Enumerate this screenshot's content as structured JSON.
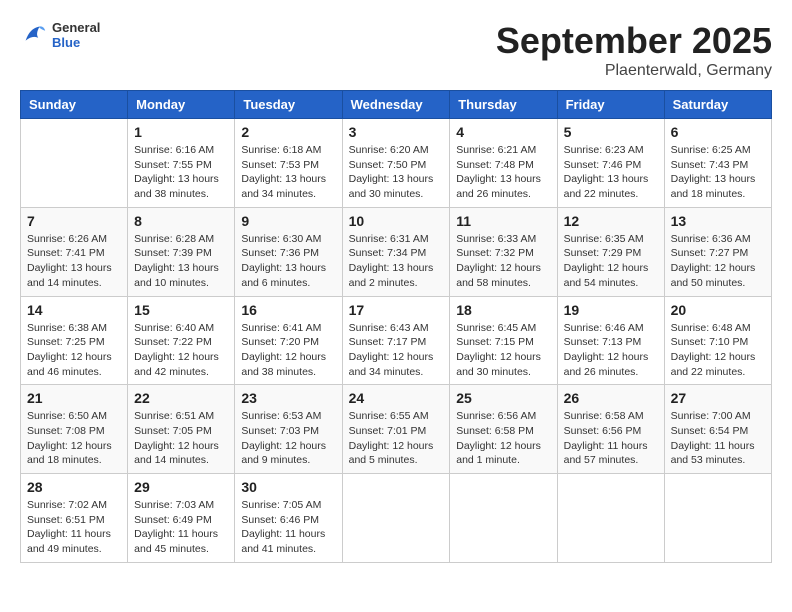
{
  "header": {
    "logo_general": "General",
    "logo_blue": "Blue",
    "month": "September 2025",
    "location": "Plaenterwald, Germany"
  },
  "weekdays": [
    "Sunday",
    "Monday",
    "Tuesday",
    "Wednesday",
    "Thursday",
    "Friday",
    "Saturday"
  ],
  "weeks": [
    [
      {
        "day": "",
        "info": ""
      },
      {
        "day": "1",
        "info": "Sunrise: 6:16 AM\nSunset: 7:55 PM\nDaylight: 13 hours\nand 38 minutes."
      },
      {
        "day": "2",
        "info": "Sunrise: 6:18 AM\nSunset: 7:53 PM\nDaylight: 13 hours\nand 34 minutes."
      },
      {
        "day": "3",
        "info": "Sunrise: 6:20 AM\nSunset: 7:50 PM\nDaylight: 13 hours\nand 30 minutes."
      },
      {
        "day": "4",
        "info": "Sunrise: 6:21 AM\nSunset: 7:48 PM\nDaylight: 13 hours\nand 26 minutes."
      },
      {
        "day": "5",
        "info": "Sunrise: 6:23 AM\nSunset: 7:46 PM\nDaylight: 13 hours\nand 22 minutes."
      },
      {
        "day": "6",
        "info": "Sunrise: 6:25 AM\nSunset: 7:43 PM\nDaylight: 13 hours\nand 18 minutes."
      }
    ],
    [
      {
        "day": "7",
        "info": "Sunrise: 6:26 AM\nSunset: 7:41 PM\nDaylight: 13 hours\nand 14 minutes."
      },
      {
        "day": "8",
        "info": "Sunrise: 6:28 AM\nSunset: 7:39 PM\nDaylight: 13 hours\nand 10 minutes."
      },
      {
        "day": "9",
        "info": "Sunrise: 6:30 AM\nSunset: 7:36 PM\nDaylight: 13 hours\nand 6 minutes."
      },
      {
        "day": "10",
        "info": "Sunrise: 6:31 AM\nSunset: 7:34 PM\nDaylight: 13 hours\nand 2 minutes."
      },
      {
        "day": "11",
        "info": "Sunrise: 6:33 AM\nSunset: 7:32 PM\nDaylight: 12 hours\nand 58 minutes."
      },
      {
        "day": "12",
        "info": "Sunrise: 6:35 AM\nSunset: 7:29 PM\nDaylight: 12 hours\nand 54 minutes."
      },
      {
        "day": "13",
        "info": "Sunrise: 6:36 AM\nSunset: 7:27 PM\nDaylight: 12 hours\nand 50 minutes."
      }
    ],
    [
      {
        "day": "14",
        "info": "Sunrise: 6:38 AM\nSunset: 7:25 PM\nDaylight: 12 hours\nand 46 minutes."
      },
      {
        "day": "15",
        "info": "Sunrise: 6:40 AM\nSunset: 7:22 PM\nDaylight: 12 hours\nand 42 minutes."
      },
      {
        "day": "16",
        "info": "Sunrise: 6:41 AM\nSunset: 7:20 PM\nDaylight: 12 hours\nand 38 minutes."
      },
      {
        "day": "17",
        "info": "Sunrise: 6:43 AM\nSunset: 7:17 PM\nDaylight: 12 hours\nand 34 minutes."
      },
      {
        "day": "18",
        "info": "Sunrise: 6:45 AM\nSunset: 7:15 PM\nDaylight: 12 hours\nand 30 minutes."
      },
      {
        "day": "19",
        "info": "Sunrise: 6:46 AM\nSunset: 7:13 PM\nDaylight: 12 hours\nand 26 minutes."
      },
      {
        "day": "20",
        "info": "Sunrise: 6:48 AM\nSunset: 7:10 PM\nDaylight: 12 hours\nand 22 minutes."
      }
    ],
    [
      {
        "day": "21",
        "info": "Sunrise: 6:50 AM\nSunset: 7:08 PM\nDaylight: 12 hours\nand 18 minutes."
      },
      {
        "day": "22",
        "info": "Sunrise: 6:51 AM\nSunset: 7:05 PM\nDaylight: 12 hours\nand 14 minutes."
      },
      {
        "day": "23",
        "info": "Sunrise: 6:53 AM\nSunset: 7:03 PM\nDaylight: 12 hours\nand 9 minutes."
      },
      {
        "day": "24",
        "info": "Sunrise: 6:55 AM\nSunset: 7:01 PM\nDaylight: 12 hours\nand 5 minutes."
      },
      {
        "day": "25",
        "info": "Sunrise: 6:56 AM\nSunset: 6:58 PM\nDaylight: 12 hours\nand 1 minute."
      },
      {
        "day": "26",
        "info": "Sunrise: 6:58 AM\nSunset: 6:56 PM\nDaylight: 11 hours\nand 57 minutes."
      },
      {
        "day": "27",
        "info": "Sunrise: 7:00 AM\nSunset: 6:54 PM\nDaylight: 11 hours\nand 53 minutes."
      }
    ],
    [
      {
        "day": "28",
        "info": "Sunrise: 7:02 AM\nSunset: 6:51 PM\nDaylight: 11 hours\nand 49 minutes."
      },
      {
        "day": "29",
        "info": "Sunrise: 7:03 AM\nSunset: 6:49 PM\nDaylight: 11 hours\nand 45 minutes."
      },
      {
        "day": "30",
        "info": "Sunrise: 7:05 AM\nSunset: 6:46 PM\nDaylight: 11 hours\nand 41 minutes."
      },
      {
        "day": "",
        "info": ""
      },
      {
        "day": "",
        "info": ""
      },
      {
        "day": "",
        "info": ""
      },
      {
        "day": "",
        "info": ""
      }
    ]
  ]
}
